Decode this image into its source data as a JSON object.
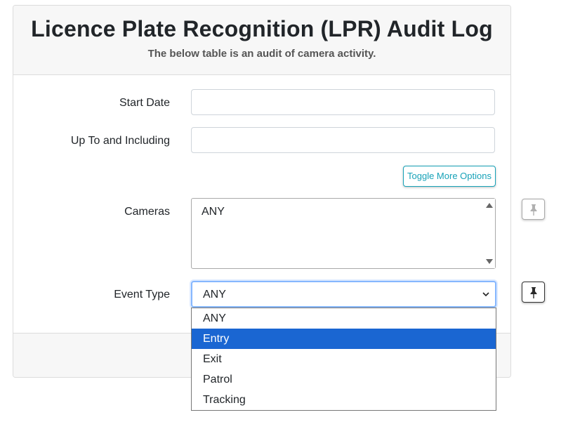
{
  "header": {
    "title": "Licence Plate Recognition (LPR) Audit Log",
    "subtitle": "The below table is an audit of camera activity."
  },
  "form": {
    "start_date": {
      "label": "Start Date",
      "value": ""
    },
    "end_date": {
      "label": "Up To and Including",
      "value": ""
    },
    "toggle_button": "Toggle More Options",
    "cameras": {
      "label": "Cameras",
      "selected": "ANY"
    },
    "event_type": {
      "label": "Event Type",
      "value": "ANY",
      "options": [
        "ANY",
        "Entry",
        "Exit",
        "Patrol",
        "Tracking"
      ],
      "highlighted": "Entry"
    }
  },
  "icons": {
    "cameras_pin": "pin-icon",
    "event_type_pin": "pin-icon"
  },
  "colors": {
    "accent": "#17a2b8",
    "focus_border": "#86b7fe",
    "highlight": "#1a66d2"
  }
}
